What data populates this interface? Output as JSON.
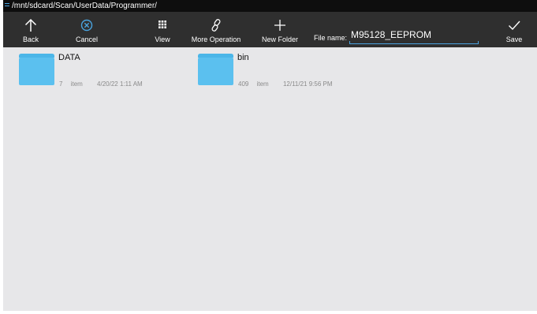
{
  "path_bar": {
    "text": "/mnt/sdcard/Scan/UserData/Programmer/"
  },
  "toolbar": {
    "back_label": "Back",
    "cancel_label": "Cancel",
    "view_label": "View",
    "more_label": "More Operation",
    "new_folder_label": "New Folder",
    "file_name_label": "File name:",
    "file_name_value": "M95128_EEPROM",
    "save_label": "Save"
  },
  "files": [
    {
      "name": "DATA",
      "count": "7",
      "count_unit": "item",
      "modified": "4/20/22 1:11 AM",
      "icon": "folder-icon"
    },
    {
      "name": "bin",
      "count": "409",
      "count_unit": "item",
      "modified": "12/11/21 9:56 PM",
      "icon": "folder-icon"
    }
  ],
  "colors": {
    "accent": "#4aa3df",
    "toolbar_bg": "#2f2f2f",
    "content_bg": "#e7e7e9",
    "folder": "#5bc0ef"
  }
}
